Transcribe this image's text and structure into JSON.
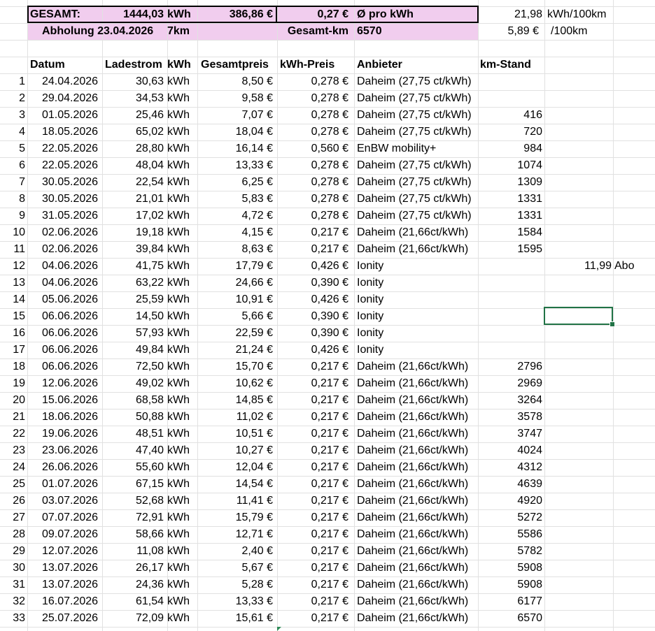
{
  "summary": {
    "gesamt_label": "GESAMT:",
    "total_kwh": "1444,03",
    "kwh_unit": "kWh",
    "total_price": "386,86 €",
    "avg_price": "0,27 €",
    "avg_label": "Ø pro kWh",
    "consumption": "21,98",
    "consumption_unit": "kWh/100km",
    "pickup_label": "Abholung 23.04.2026",
    "pickup_km": "7km",
    "total_km_label": "Gesamt-km",
    "total_km": "6570",
    "cost_per_100": "5,89 €",
    "cost_per_100_unit": "/100km"
  },
  "headers": {
    "datum": "Datum",
    "ladestrom": "Ladestrom",
    "kwh": "kWh",
    "gesamtpreis": "Gesamtpreis",
    "kwh_preis": "kWh-Preis",
    "anbieter": "Anbieter",
    "km_stand": "km-Stand"
  },
  "rows": [
    {
      "n": "1",
      "date": "24.04.2026",
      "kwh": "30,63",
      "unit": "kWh",
      "price": "8,50 €",
      "kprice": "0,278 €",
      "provider": "Daheim (27,75 ct/kWh)",
      "km": ""
    },
    {
      "n": "2",
      "date": "29.04.2026",
      "kwh": "34,53",
      "unit": "kWh",
      "price": "9,58 €",
      "kprice": "0,278 €",
      "provider": "Daheim (27,75 ct/kWh)",
      "km": ""
    },
    {
      "n": "3",
      "date": "01.05.2026",
      "kwh": "25,46",
      "unit": "kWh",
      "price": "7,07 €",
      "kprice": "0,278 €",
      "provider": "Daheim (27,75 ct/kWh)",
      "km": "416"
    },
    {
      "n": "4",
      "date": "18.05.2026",
      "kwh": "65,02",
      "unit": "kWh",
      "price": "18,04 €",
      "kprice": "0,278 €",
      "provider": "Daheim (27,75 ct/kWh)",
      "km": "720"
    },
    {
      "n": "5",
      "date": "22.05.2026",
      "kwh": "28,80",
      "unit": "kWh",
      "price": "16,14 €",
      "kprice": "0,560 €",
      "provider": "EnBW mobility+",
      "km": "984"
    },
    {
      "n": "6",
      "date": "22.05.2026",
      "kwh": "48,04",
      "unit": "kWh",
      "price": "13,33 €",
      "kprice": "0,278 €",
      "provider": "Daheim (27,75 ct/kWh)",
      "km": "1074"
    },
    {
      "n": "7",
      "date": "30.05.2026",
      "kwh": "22,54",
      "unit": "kWh",
      "price": "6,25 €",
      "kprice": "0,278 €",
      "provider": "Daheim (27,75 ct/kWh)",
      "km": "1309"
    },
    {
      "n": "8",
      "date": "30.05.2026",
      "kwh": "21,01",
      "unit": "kWh",
      "price": "5,83 €",
      "kprice": "0,278 €",
      "provider": "Daheim (27,75 ct/kWh)",
      "km": "1331"
    },
    {
      "n": "9",
      "date": "31.05.2026",
      "kwh": "17,02",
      "unit": "kWh",
      "price": "4,72 €",
      "kprice": "0,278 €",
      "provider": "Daheim (27,75 ct/kWh)",
      "km": "1331"
    },
    {
      "n": "10",
      "date": "02.06.2026",
      "kwh": "19,18",
      "unit": "kWh",
      "price": "4,15 €",
      "kprice": "0,217 €",
      "provider": "Daheim (21,66ct/kWh)",
      "km": "1584"
    },
    {
      "n": "11",
      "date": "02.06.2026",
      "kwh": "39,84",
      "unit": "kWh",
      "price": "8,63 €",
      "kprice": "0,217 €",
      "provider": "Daheim (21,66ct/kWh)",
      "km": "1595"
    },
    {
      "n": "12",
      "date": "04.06.2026",
      "kwh": "41,75",
      "unit": "kWh",
      "price": "17,79 €",
      "kprice": "0,426 €",
      "provider": "Ionity",
      "km": ""
    },
    {
      "n": "13",
      "date": "04.06.2026",
      "kwh": "63,22",
      "unit": "kWh",
      "price": "24,66 €",
      "kprice": "0,390 €",
      "provider": "Ionity",
      "km": ""
    },
    {
      "n": "14",
      "date": "05.06.2026",
      "kwh": "25,59",
      "unit": "kWh",
      "price": "10,91 €",
      "kprice": "0,426 €",
      "provider": "Ionity",
      "km": ""
    },
    {
      "n": "15",
      "date": "06.06.2026",
      "kwh": "14,50",
      "unit": "kWh",
      "price": "5,66 €",
      "kprice": "0,390 €",
      "provider": "Ionity",
      "km": ""
    },
    {
      "n": "16",
      "date": "06.06.2026",
      "kwh": "57,93",
      "unit": "kWh",
      "price": "22,59 €",
      "kprice": "0,390 €",
      "provider": "Ionity",
      "km": ""
    },
    {
      "n": "17",
      "date": "06.06.2026",
      "kwh": "49,84",
      "unit": "kWh",
      "price": "21,24 €",
      "kprice": "0,426 €",
      "provider": "Ionity",
      "km": ""
    },
    {
      "n": "18",
      "date": "06.06.2026",
      "kwh": "72,50",
      "unit": "kWh",
      "price": "15,70 €",
      "kprice": "0,217 €",
      "provider": "Daheim (21,66ct/kWh)",
      "km": "2796"
    },
    {
      "n": "19",
      "date": "12.06.2026",
      "kwh": "49,02",
      "unit": "kWh",
      "price": "10,62 €",
      "kprice": "0,217 €",
      "provider": "Daheim (21,66ct/kWh)",
      "km": "2969"
    },
    {
      "n": "20",
      "date": "15.06.2026",
      "kwh": "68,58",
      "unit": "kWh",
      "price": "14,85 €",
      "kprice": "0,217 €",
      "provider": "Daheim (21,66ct/kWh)",
      "km": "3264"
    },
    {
      "n": "21",
      "date": "18.06.2026",
      "kwh": "50,88",
      "unit": "kWh",
      "price": "11,02 €",
      "kprice": "0,217 €",
      "provider": "Daheim (21,66ct/kWh)",
      "km": "3578"
    },
    {
      "n": "22",
      "date": "19.06.2026",
      "kwh": "48,51",
      "unit": "kWh",
      "price": "10,51 €",
      "kprice": "0,217 €",
      "provider": "Daheim (21,66ct/kWh)",
      "km": "3747"
    },
    {
      "n": "23",
      "date": "23.06.2026",
      "kwh": "47,40",
      "unit": "kWh",
      "price": "10,27 €",
      "kprice": "0,217 €",
      "provider": "Daheim (21,66ct/kWh)",
      "km": "4024"
    },
    {
      "n": "24",
      "date": "26.06.2026",
      "kwh": "55,60",
      "unit": "kWh",
      "price": "12,04 €",
      "kprice": "0,217 €",
      "provider": "Daheim (21,66ct/kWh)",
      "km": "4312"
    },
    {
      "n": "25",
      "date": "01.07.2026",
      "kwh": "67,15",
      "unit": "kWh",
      "price": "14,54 €",
      "kprice": "0,217 €",
      "provider": "Daheim (21,66ct/kWh)",
      "km": "4639"
    },
    {
      "n": "26",
      "date": "03.07.2026",
      "kwh": "52,68",
      "unit": "kWh",
      "price": "11,41 €",
      "kprice": "0,217 €",
      "provider": "Daheim (21,66ct/kWh)",
      "km": "4920"
    },
    {
      "n": "27",
      "date": "07.07.2026",
      "kwh": "72,91",
      "unit": "kWh",
      "price": "15,79 €",
      "kprice": "0,217 €",
      "provider": "Daheim (21,66ct/kWh)",
      "km": "5272"
    },
    {
      "n": "28",
      "date": "09.07.2026",
      "kwh": "58,66",
      "unit": "kWh",
      "price": "12,71 €",
      "kprice": "0,217 €",
      "provider": "Daheim (21,66ct/kWh)",
      "km": "5586"
    },
    {
      "n": "29",
      "date": "12.07.2026",
      "kwh": "11,08",
      "unit": "kWh",
      "price": "2,40 €",
      "kprice": "0,217 €",
      "provider": "Daheim (21,66ct/kWh)",
      "km": "5782"
    },
    {
      "n": "30",
      "date": "13.07.2026",
      "kwh": "26,17",
      "unit": "kWh",
      "price": "5,67 €",
      "kprice": "0,217 €",
      "provider": "Daheim (21,66ct/kWh)",
      "km": "5908"
    },
    {
      "n": "31",
      "date": "13.07.2026",
      "kwh": "24,36",
      "unit": "kWh",
      "price": "5,28 €",
      "kprice": "0,217 €",
      "provider": "Daheim (21,66ct/kWh)",
      "km": "5908"
    },
    {
      "n": "32",
      "date": "16.07.2026",
      "kwh": "61,54",
      "unit": "kWh",
      "price": "13,33 €",
      "kprice": "0,217 €",
      "provider": "Daheim (21,66ct/kWh)",
      "km": "6177"
    },
    {
      "n": "33",
      "date": "25.07.2026",
      "kwh": "72,09",
      "unit": "kWh",
      "price": "15,61 €",
      "kprice": "0,217 €",
      "provider": "Daheim (21,66ct/kWh)",
      "km": "6570"
    }
  ],
  "side_note": {
    "value": "11,99",
    "label": "Abo"
  },
  "colors": {
    "summary_fill": "#f1cdee",
    "gridline": "#e1e1e1",
    "selection": "#217346"
  }
}
